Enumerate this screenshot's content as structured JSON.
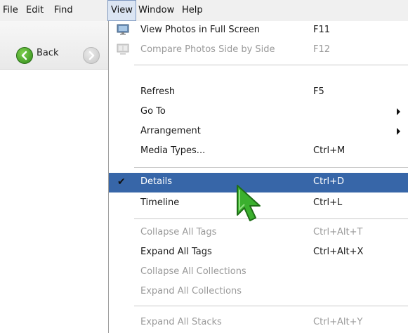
{
  "menubar": {
    "items": [
      {
        "label": "File"
      },
      {
        "label": "Edit"
      },
      {
        "label": "Find"
      },
      {
        "label": "View"
      },
      {
        "label": "Window"
      },
      {
        "label": "Help"
      }
    ]
  },
  "toolbar": {
    "back_label": "Back"
  },
  "view_menu": {
    "full_screen": {
      "label": "View Photos in Full Screen",
      "shortcut": "F11"
    },
    "side_by_side": {
      "label": "Compare Photos Side by Side",
      "shortcut": "F12"
    },
    "refresh": {
      "label": "Refresh",
      "shortcut": "F5"
    },
    "go_to": {
      "label": "Go To"
    },
    "arrangement": {
      "label": "Arrangement"
    },
    "media_types": {
      "label": "Media Types...",
      "shortcut": "Ctrl+M"
    },
    "details": {
      "label": "Details",
      "shortcut": "Ctrl+D"
    },
    "timeline": {
      "label": "Timeline",
      "shortcut": "Ctrl+L"
    },
    "collapse_tags": {
      "label": "Collapse All Tags",
      "shortcut": "Ctrl+Alt+T"
    },
    "expand_tags": {
      "label": "Expand All Tags",
      "shortcut": "Ctrl+Alt+X"
    },
    "collapse_collections": {
      "label": "Collapse All Collections"
    },
    "expand_collections": {
      "label": "Expand All Collections"
    },
    "expand_stacks": {
      "label": "Expand All Stacks",
      "shortcut": "Ctrl+Alt+Y"
    }
  },
  "colors": {
    "highlight": "#3766a8",
    "cursor": "#3bb02e"
  }
}
